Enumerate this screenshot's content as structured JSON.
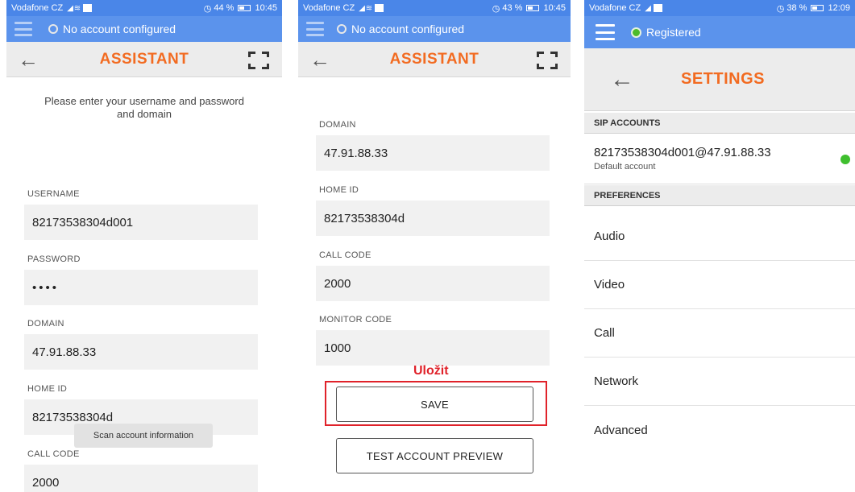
{
  "screens": [
    {
      "status_bar": {
        "carrier": "Vodafone CZ",
        "battery": "44 %",
        "time": "10:45"
      },
      "account_status": "No account configured",
      "header": {
        "title": "ASSISTANT"
      },
      "intro": "Please enter your username and password and domain",
      "fields": [
        {
          "label": "USERNAME",
          "value": "82173538304d001"
        },
        {
          "label": "PASSWORD",
          "value": "••••"
        },
        {
          "label": "DOMAIN",
          "value": "47.91.88.33"
        },
        {
          "label": "HOME ID",
          "value": "82173538304d"
        },
        {
          "label": "CALL CODE",
          "value": "2000"
        }
      ],
      "toast": "Scan account information"
    },
    {
      "status_bar": {
        "carrier": "Vodafone CZ",
        "battery": "43 %",
        "time": "10:45"
      },
      "account_status": "No account configured",
      "header": {
        "title": "ASSISTANT"
      },
      "fields": [
        {
          "label": "DOMAIN",
          "value": "47.91.88.33"
        },
        {
          "label": "HOME ID",
          "value": "82173538304d"
        },
        {
          "label": "CALL CODE",
          "value": "2000"
        },
        {
          "label": "MONITOR CODE",
          "value": "1000"
        }
      ],
      "annotation": "Uložit",
      "save_label": "SAVE",
      "test_label": "TEST ACCOUNT PREVIEW",
      "annotation_color": "#e0222a"
    },
    {
      "status_bar": {
        "carrier": "Vodafone CZ",
        "battery": "38 %",
        "time": "12:09"
      },
      "account_status": "Registered",
      "header": {
        "title": "SETTINGS"
      },
      "sip_section": "SIP ACCOUNTS",
      "account": {
        "uri": "82173538304d001@47.91.88.33",
        "subtitle": "Default account"
      },
      "pref_section": "PREFERENCES",
      "preferences": [
        "Audio",
        "Video",
        "Call",
        "Network",
        "Advanced"
      ]
    }
  ],
  "colors": {
    "accent": "#f26b21",
    "status_bar": "#4a86e8",
    "registered": "#3fbf2e"
  }
}
